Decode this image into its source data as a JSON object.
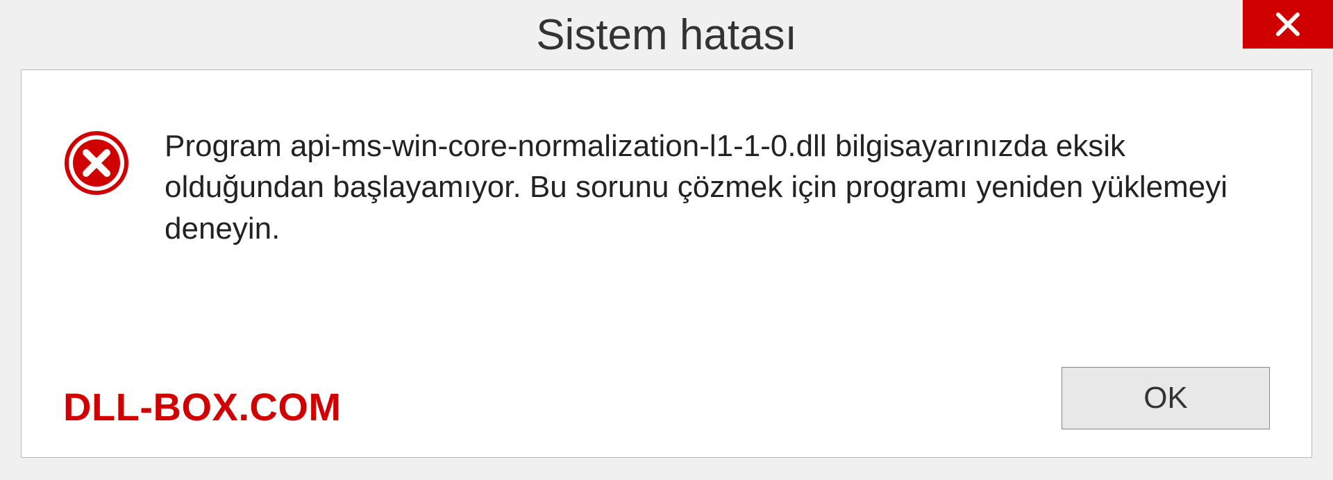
{
  "dialog": {
    "title": "Sistem hatası",
    "message": "Program api-ms-win-core-normalization-l1-1-0.dll bilgisayarınızda eksik olduğundan başlayamıyor. Bu sorunu çözmek için programı yeniden yüklemeyi deneyin.",
    "ok_label": "OK",
    "watermark": "DLL-BOX.COM"
  },
  "colors": {
    "error_red": "#d10000",
    "panel_bg": "#ffffff",
    "dialog_bg": "#f0f0f0"
  }
}
